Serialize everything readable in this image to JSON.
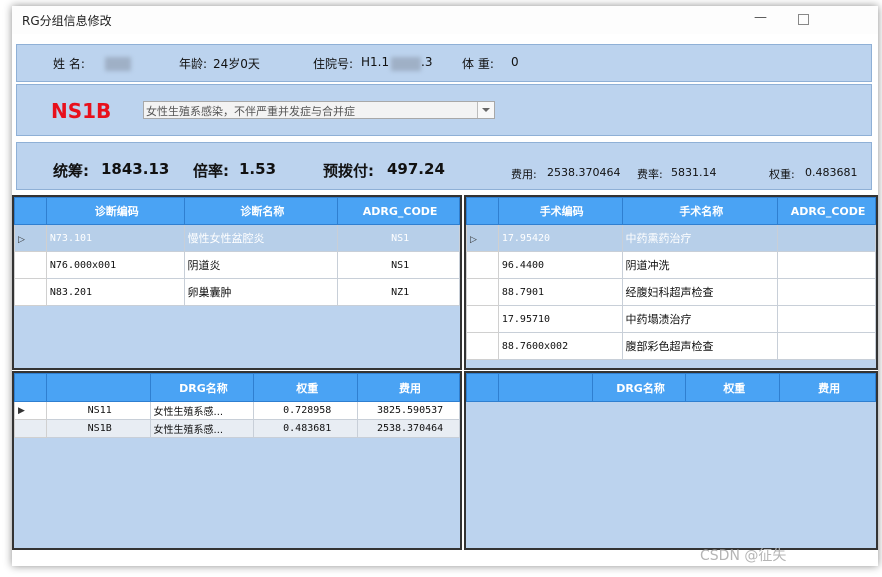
{
  "window": {
    "title": "RG分组信息修改",
    "minimize": "—"
  },
  "patient": {
    "name_label": "姓 名:",
    "age_label": "年龄:",
    "age_value": "24岁0天",
    "inpatient_label": "住院号:",
    "inpatient_prefix": "H1.1",
    "inpatient_suffix": ".3",
    "weight_label": "体 重:",
    "weight_value": "0"
  },
  "drg": {
    "code": "NS1B",
    "selected": "女性生殖系感染，不伴严重并发症与合并症"
  },
  "summary": {
    "pooling_label": "统筹:",
    "pooling_value": "1843.13",
    "ratio_label": "倍率:",
    "ratio_value": "1.53",
    "prepay_label": "预拨付:",
    "prepay_value": "497.24",
    "cost_label": "费用:",
    "cost_value": "2538.370464",
    "rate_label": "费率:",
    "rate_value": "5831.14",
    "weight_label": "权重:",
    "weight_value": "0.483681"
  },
  "diagnosis": {
    "headers": [
      "诊断编码",
      "诊断名称",
      "ADRG_CODE"
    ],
    "rows": [
      {
        "code": "N73.101",
        "name": "慢性女性盆腔炎",
        "adrg": "NS1",
        "selected": true
      },
      {
        "code": "N76.000x001",
        "name": "阴道炎",
        "adrg": "NS1",
        "selected": false
      },
      {
        "code": "N83.201",
        "name": "卵巢囊肿",
        "adrg": "NZ1",
        "selected": false
      }
    ]
  },
  "surgery": {
    "headers": [
      "手术编码",
      "手术名称",
      "ADRG_CODE"
    ],
    "rows": [
      {
        "code": "17.95420",
        "name": "中药熏药治疗",
        "adrg": "",
        "selected": true
      },
      {
        "code": "96.4400",
        "name": "阴道冲洗",
        "adrg": "",
        "selected": false
      },
      {
        "code": "88.7901",
        "name": "经腹妇科超声检查",
        "adrg": "",
        "selected": false
      },
      {
        "code": "17.95710",
        "name": "中药塌渍治疗",
        "adrg": "",
        "selected": false
      },
      {
        "code": "88.7600x002",
        "name": "腹部彩色超声检查",
        "adrg": "",
        "selected": false
      }
    ]
  },
  "drg_list": {
    "headers": [
      "",
      "DRG名称",
      "权重",
      "费用"
    ],
    "rows": [
      {
        "code": "NS11",
        "name": "女性生殖系感...",
        "weight": "0.728958",
        "cost": "3825.590537",
        "current": true
      },
      {
        "code": "NS1B",
        "name": "女性生殖系感...",
        "weight": "0.483681",
        "cost": "2538.370464",
        "current": false
      }
    ]
  },
  "drg_list2": {
    "headers": [
      "",
      "DRG名称",
      "权重",
      "费用"
    ]
  },
  "watermark": "CSDN @征失"
}
